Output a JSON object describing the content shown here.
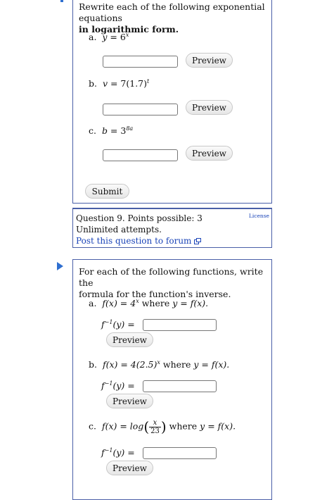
{
  "q8": {
    "prompt_line1": "Rewrite each of the following exponential equations",
    "prompt_line2": "in logarithmic form.",
    "parts": [
      {
        "letter": "a.",
        "lhs": "y",
        "base": "6",
        "exp": "x"
      },
      {
        "letter": "b.",
        "lhs": "v",
        "coef": "7(1.7)",
        "exp": "t"
      },
      {
        "letter": "c.",
        "lhs": "b",
        "base": "3",
        "exp": "8a"
      }
    ],
    "preview_label": "Preview",
    "submit_label": "Submit"
  },
  "meta": {
    "question_points": "Question 9. Points possible: 3",
    "attempts": "Unlimited attempts.",
    "forum_link": "Post this question to forum",
    "license": "License"
  },
  "q10": {
    "prompt_line1": "For each of the following functions, write the",
    "prompt_line2": "formula for the function's inverse.",
    "parts": [
      {
        "letter": "a.",
        "where_text": "where",
        "func": "f(x) = 4",
        "exp": "x",
        "tail": "y = f(x)."
      },
      {
        "letter": "b.",
        "where_text": "where",
        "func": "f(x) = 4(2.5)",
        "exp": "x",
        "tail": "y = f(x)."
      },
      {
        "letter": "c.",
        "where_text": "where",
        "func": "f(x) = log",
        "frac_num": "x",
        "frac_den": "23",
        "tail": "y = f(x)."
      }
    ],
    "inverse_label": "f",
    "inverse_sup": "−1",
    "inverse_arg": "(y) =",
    "preview_label": "Preview"
  }
}
